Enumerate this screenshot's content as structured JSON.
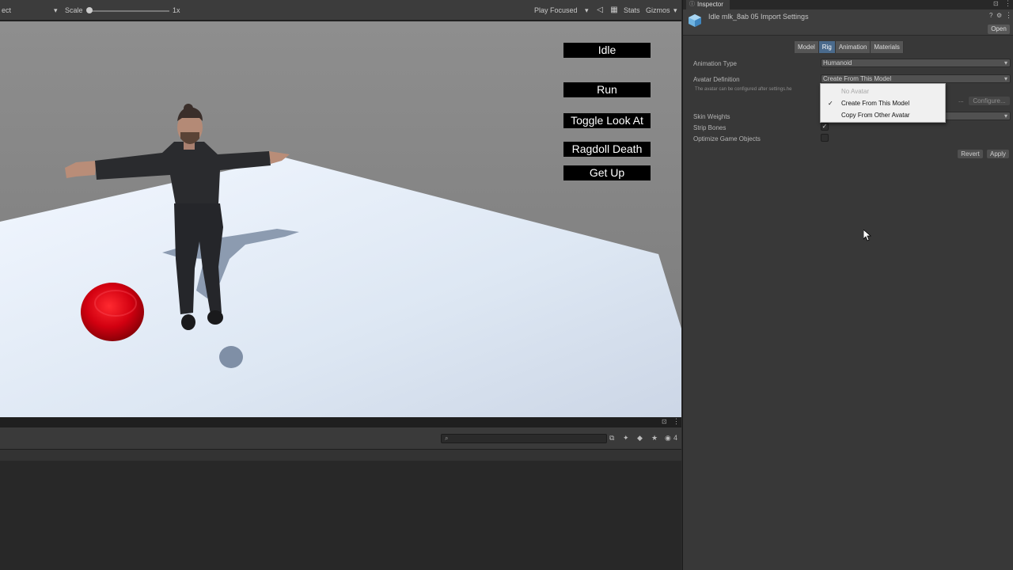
{
  "game_toolbar": {
    "display_dropdown": "ect",
    "scale_label": "Scale",
    "scale_value": "1x",
    "play_focused": "Play Focused",
    "stats": "Stats",
    "gizmos": "Gizmos"
  },
  "game_buttons": [
    "Idle",
    "Run",
    "Toggle Look At",
    "Ragdoll Death",
    "Get Up"
  ],
  "console": {
    "search_placeholder": "",
    "log_count": "4"
  },
  "inspector": {
    "tab_title": "Inspector",
    "asset_title": "Idle mlk_8ab 05 Import Settings",
    "open_button": "Open",
    "tabs": [
      "Model",
      "Rig",
      "Animation",
      "Materials"
    ],
    "active_tab": "Rig",
    "animation_type_label": "Animation Type",
    "animation_type_value": "Humanoid",
    "avatar_definition_label": "Avatar Definition",
    "avatar_definition_value": "Create From This Model",
    "avatar_info": "The avatar can be configured after settings.he",
    "configure_button": "Configure...",
    "configure_ellipsis": "...",
    "skin_weights_label": "Skin Weights",
    "strip_bones_label": "Strip Bones",
    "optimize_label": "Optimize Game Objects",
    "revert_button": "Revert",
    "apply_button": "Apply"
  },
  "popup": {
    "items": [
      "No Avatar",
      "Create From This Model",
      "Copy From Other Avatar"
    ],
    "selected": "Create From This Model"
  },
  "colors": {
    "sky": "#8c8c8c",
    "ground": "#e6eef8",
    "ball": "#cc0010",
    "active_tab": "#4a6a8c"
  }
}
